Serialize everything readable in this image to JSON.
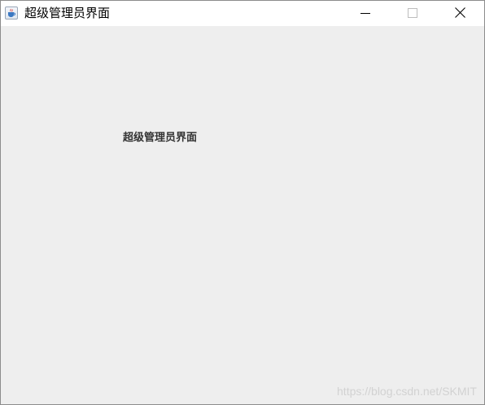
{
  "window": {
    "title": "超级管理员界面",
    "app_icon": "java-cup-icon",
    "controls": {
      "minimize_icon": "minimize-icon",
      "maximize_icon": "maximize-icon",
      "close_icon": "close-icon"
    }
  },
  "content": {
    "heading": "超级管理员界面"
  },
  "watermark": "https://blog.csdn.net/SKMIT",
  "colors": {
    "titlebar": "#ffffff",
    "client_background": "#eeeeee",
    "window_border": "#8c8c8c",
    "heading_text": "#333333",
    "watermark_text": "#d2d2d2"
  }
}
